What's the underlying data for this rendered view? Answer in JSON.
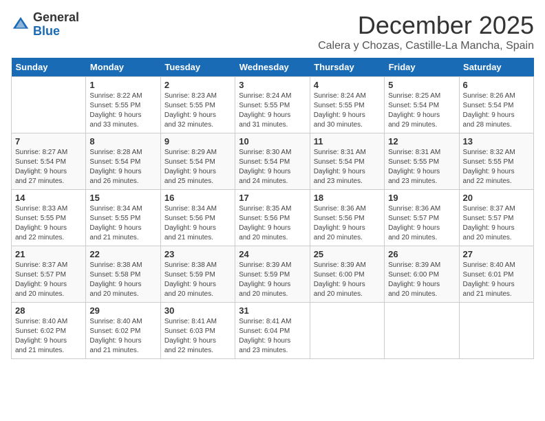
{
  "header": {
    "logo_general": "General",
    "logo_blue": "Blue",
    "month": "December 2025",
    "location": "Calera y Chozas, Castille-La Mancha, Spain"
  },
  "weekdays": [
    "Sunday",
    "Monday",
    "Tuesday",
    "Wednesday",
    "Thursday",
    "Friday",
    "Saturday"
  ],
  "weeks": [
    [
      {
        "day": "",
        "info": ""
      },
      {
        "day": "1",
        "info": "Sunrise: 8:22 AM\nSunset: 5:55 PM\nDaylight: 9 hours\nand 33 minutes."
      },
      {
        "day": "2",
        "info": "Sunrise: 8:23 AM\nSunset: 5:55 PM\nDaylight: 9 hours\nand 32 minutes."
      },
      {
        "day": "3",
        "info": "Sunrise: 8:24 AM\nSunset: 5:55 PM\nDaylight: 9 hours\nand 31 minutes."
      },
      {
        "day": "4",
        "info": "Sunrise: 8:24 AM\nSunset: 5:55 PM\nDaylight: 9 hours\nand 30 minutes."
      },
      {
        "day": "5",
        "info": "Sunrise: 8:25 AM\nSunset: 5:54 PM\nDaylight: 9 hours\nand 29 minutes."
      },
      {
        "day": "6",
        "info": "Sunrise: 8:26 AM\nSunset: 5:54 PM\nDaylight: 9 hours\nand 28 minutes."
      }
    ],
    [
      {
        "day": "7",
        "info": "Sunrise: 8:27 AM\nSunset: 5:54 PM\nDaylight: 9 hours\nand 27 minutes."
      },
      {
        "day": "8",
        "info": "Sunrise: 8:28 AM\nSunset: 5:54 PM\nDaylight: 9 hours\nand 26 minutes."
      },
      {
        "day": "9",
        "info": "Sunrise: 8:29 AM\nSunset: 5:54 PM\nDaylight: 9 hours\nand 25 minutes."
      },
      {
        "day": "10",
        "info": "Sunrise: 8:30 AM\nSunset: 5:54 PM\nDaylight: 9 hours\nand 24 minutes."
      },
      {
        "day": "11",
        "info": "Sunrise: 8:31 AM\nSunset: 5:54 PM\nDaylight: 9 hours\nand 23 minutes."
      },
      {
        "day": "12",
        "info": "Sunrise: 8:31 AM\nSunset: 5:55 PM\nDaylight: 9 hours\nand 23 minutes."
      },
      {
        "day": "13",
        "info": "Sunrise: 8:32 AM\nSunset: 5:55 PM\nDaylight: 9 hours\nand 22 minutes."
      }
    ],
    [
      {
        "day": "14",
        "info": "Sunrise: 8:33 AM\nSunset: 5:55 PM\nDaylight: 9 hours\nand 22 minutes."
      },
      {
        "day": "15",
        "info": "Sunrise: 8:34 AM\nSunset: 5:55 PM\nDaylight: 9 hours\nand 21 minutes."
      },
      {
        "day": "16",
        "info": "Sunrise: 8:34 AM\nSunset: 5:56 PM\nDaylight: 9 hours\nand 21 minutes."
      },
      {
        "day": "17",
        "info": "Sunrise: 8:35 AM\nSunset: 5:56 PM\nDaylight: 9 hours\nand 20 minutes."
      },
      {
        "day": "18",
        "info": "Sunrise: 8:36 AM\nSunset: 5:56 PM\nDaylight: 9 hours\nand 20 minutes."
      },
      {
        "day": "19",
        "info": "Sunrise: 8:36 AM\nSunset: 5:57 PM\nDaylight: 9 hours\nand 20 minutes."
      },
      {
        "day": "20",
        "info": "Sunrise: 8:37 AM\nSunset: 5:57 PM\nDaylight: 9 hours\nand 20 minutes."
      }
    ],
    [
      {
        "day": "21",
        "info": "Sunrise: 8:37 AM\nSunset: 5:57 PM\nDaylight: 9 hours\nand 20 minutes."
      },
      {
        "day": "22",
        "info": "Sunrise: 8:38 AM\nSunset: 5:58 PM\nDaylight: 9 hours\nand 20 minutes."
      },
      {
        "day": "23",
        "info": "Sunrise: 8:38 AM\nSunset: 5:59 PM\nDaylight: 9 hours\nand 20 minutes."
      },
      {
        "day": "24",
        "info": "Sunrise: 8:39 AM\nSunset: 5:59 PM\nDaylight: 9 hours\nand 20 minutes."
      },
      {
        "day": "25",
        "info": "Sunrise: 8:39 AM\nSunset: 6:00 PM\nDaylight: 9 hours\nand 20 minutes."
      },
      {
        "day": "26",
        "info": "Sunrise: 8:39 AM\nSunset: 6:00 PM\nDaylight: 9 hours\nand 20 minutes."
      },
      {
        "day": "27",
        "info": "Sunrise: 8:40 AM\nSunset: 6:01 PM\nDaylight: 9 hours\nand 21 minutes."
      }
    ],
    [
      {
        "day": "28",
        "info": "Sunrise: 8:40 AM\nSunset: 6:02 PM\nDaylight: 9 hours\nand 21 minutes."
      },
      {
        "day": "29",
        "info": "Sunrise: 8:40 AM\nSunset: 6:02 PM\nDaylight: 9 hours\nand 21 minutes."
      },
      {
        "day": "30",
        "info": "Sunrise: 8:41 AM\nSunset: 6:03 PM\nDaylight: 9 hours\nand 22 minutes."
      },
      {
        "day": "31",
        "info": "Sunrise: 8:41 AM\nSunset: 6:04 PM\nDaylight: 9 hours\nand 23 minutes."
      },
      {
        "day": "",
        "info": ""
      },
      {
        "day": "",
        "info": ""
      },
      {
        "day": "",
        "info": ""
      }
    ]
  ]
}
